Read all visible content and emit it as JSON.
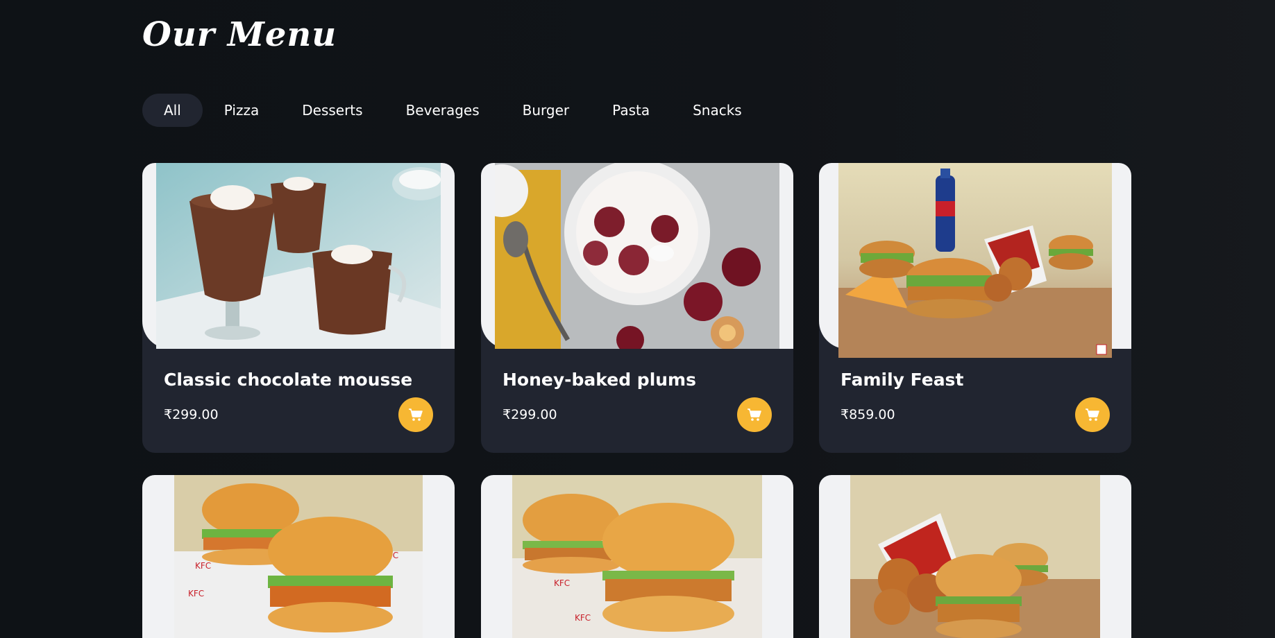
{
  "page": {
    "title": "Our Menu"
  },
  "tabs": [
    {
      "label": "All",
      "active": true
    },
    {
      "label": "Pizza"
    },
    {
      "label": "Desserts"
    },
    {
      "label": "Beverages"
    },
    {
      "label": "Burger"
    },
    {
      "label": "Pasta"
    },
    {
      "label": "Snacks"
    }
  ],
  "items": [
    {
      "name": "Classic chocolate mousse",
      "price": "₹299.00",
      "image": "chocolate-mousse-photo"
    },
    {
      "name": "Honey-baked plums",
      "price": "₹299.00",
      "image": "baked-plums-photo"
    },
    {
      "name": "Family Feast",
      "price": "₹859.00",
      "image": "family-feast-photo"
    },
    {
      "image": "zinger-burgers-photo"
    },
    {
      "image": "classic-burgers-photo"
    },
    {
      "image": "chicken-bucket-burgers-photo"
    }
  ],
  "colors": {
    "accent": "#f7b733",
    "card": "#212530",
    "background": "#0e1216"
  },
  "icons": {
    "cart": "cart-icon"
  }
}
